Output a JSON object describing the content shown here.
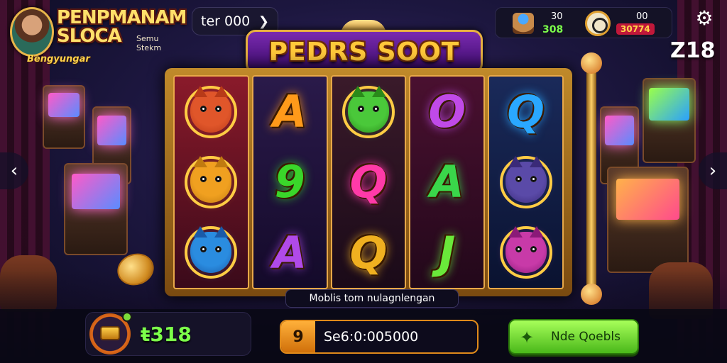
{
  "header": {
    "logo_title": "PENPMANAM\nSLOCA",
    "logo_subtitle": "Semu Stekm",
    "logo_tagline": "Bengyungar",
    "balance_pill": "ter 000",
    "stat1_top": "30",
    "stat1_bottom": "308",
    "stat2_top": "00",
    "stat2_bottom": "30774",
    "level": "Z18"
  },
  "game": {
    "title": "PEDRS SOOT",
    "info_strip": "Moblis  tom nulagnlengan"
  },
  "reels": [
    [
      {
        "kind": "animal",
        "name": "fox-symbol",
        "color": "#e0562a",
        "ear": "#b83a18"
      },
      {
        "kind": "animal",
        "name": "lion-symbol",
        "color": "#f0a020",
        "ear": "#c07a10"
      },
      {
        "kind": "animal",
        "name": "panther-symbol",
        "color": "#2a8ce0",
        "ear": "#1a5aa8"
      }
    ],
    [
      {
        "kind": "letter",
        "name": "symbol-A-orange",
        "text": "A",
        "color": "#ff9a1a"
      },
      {
        "kind": "letter",
        "name": "symbol-9-green",
        "text": "9",
        "color": "#3ad62a"
      },
      {
        "kind": "letter",
        "name": "symbol-A-purple",
        "text": "A",
        "color": "#b04ae8"
      }
    ],
    [
      {
        "kind": "animal",
        "name": "bull-symbol",
        "color": "#4ac83a",
        "ear": "#2a8a1a"
      },
      {
        "kind": "letter",
        "name": "symbol-Q-pink",
        "text": "Q",
        "color": "#ff3aa8"
      },
      {
        "kind": "letter",
        "name": "symbol-Q-gold",
        "text": "Q",
        "color": "#f0b020"
      }
    ],
    [
      {
        "kind": "letter",
        "name": "symbol-O-purple",
        "text": "O",
        "color": "#c04ae8"
      },
      {
        "kind": "letter",
        "name": "symbol-A-green",
        "text": "A",
        "color": "#3ad64a"
      },
      {
        "kind": "letter",
        "name": "symbol-J-green",
        "text": "J",
        "color": "#6ae83a"
      }
    ],
    [
      {
        "kind": "letter",
        "name": "symbol-Q-blue",
        "text": "Q",
        "color": "#2aa8ff"
      },
      {
        "kind": "animal",
        "name": "wolf-symbol",
        "color": "#5a4aa8",
        "ear": "#3a2a78"
      },
      {
        "kind": "animal",
        "name": "bear-symbol",
        "color": "#c83aa8",
        "ear": "#8a1a78"
      }
    ]
  ],
  "footer": {
    "balance": "318",
    "bet_icon": "9",
    "bet_value": "Se6:0:005000",
    "spin_label": "Nde Qoebls"
  },
  "colors": {
    "accent_gold": "#e8b040",
    "spin_green": "#4ab81a",
    "win_green": "#7cff4a"
  }
}
